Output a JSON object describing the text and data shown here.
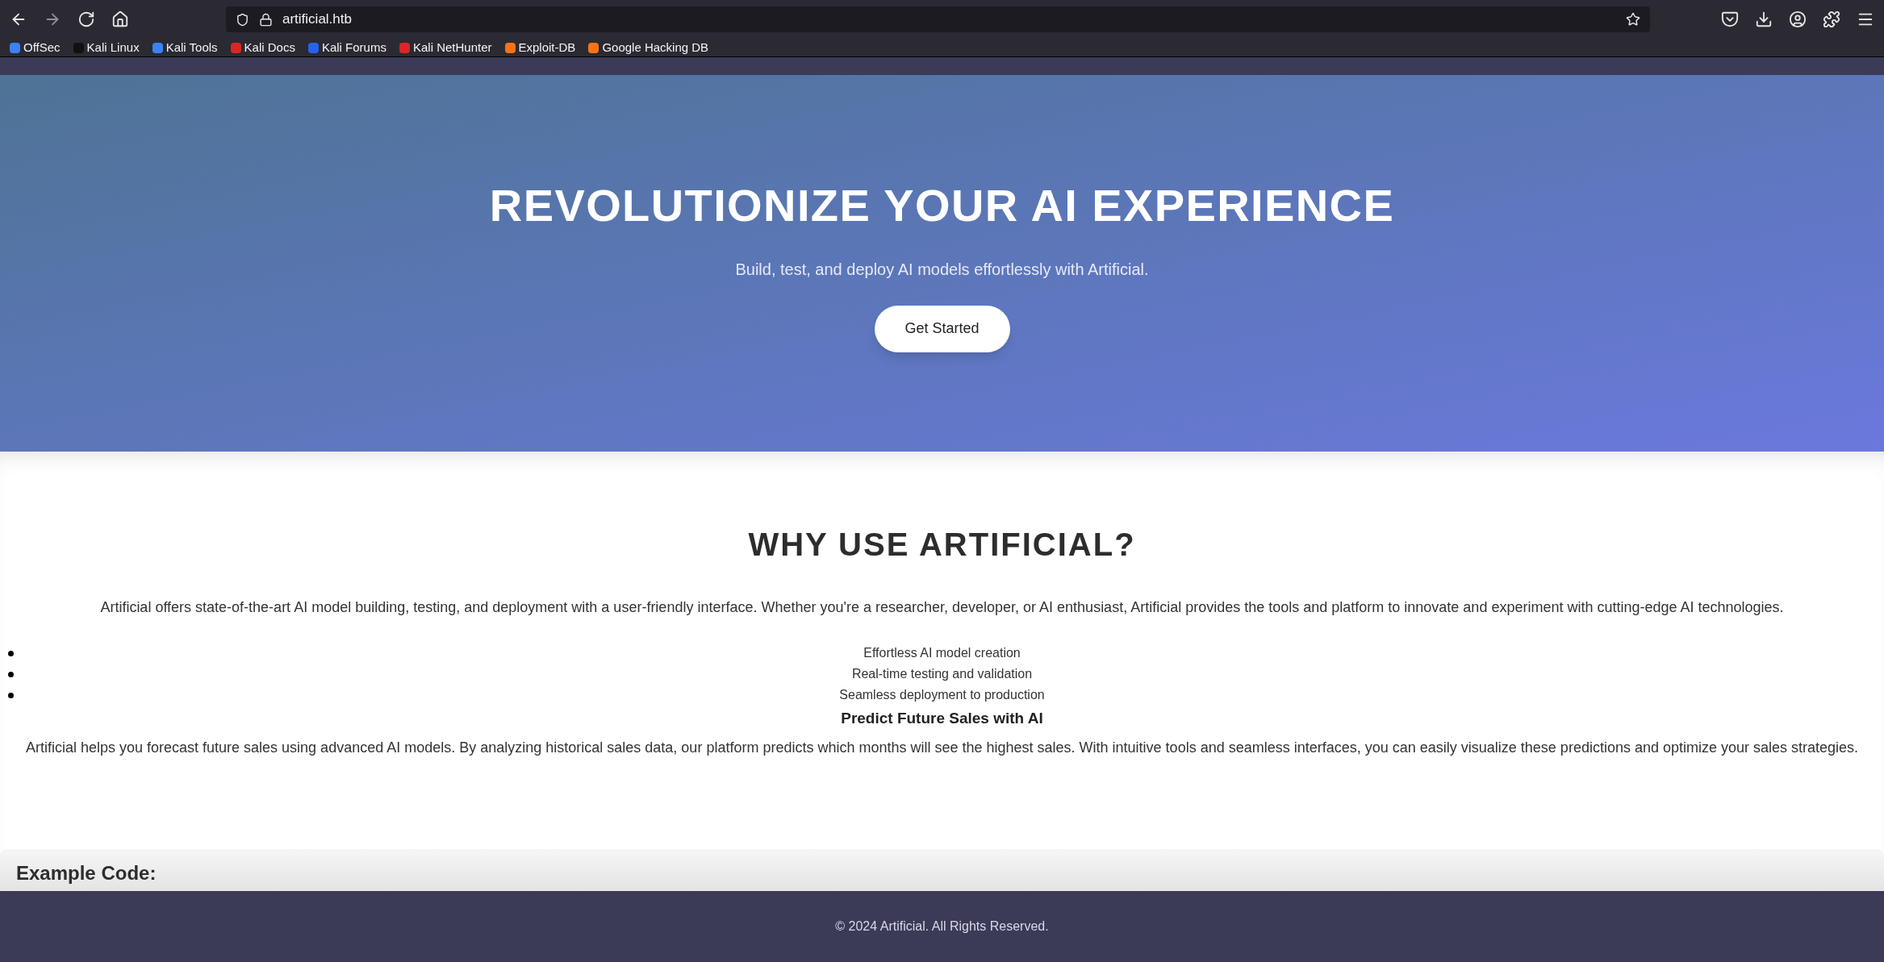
{
  "browser": {
    "url": "artificial.htb",
    "bookmarks": [
      {
        "label": "OffSec",
        "color": "#3b82f6"
      },
      {
        "label": "Kali Linux",
        "color": "#111111"
      },
      {
        "label": "Kali Tools",
        "color": "#3b82f6"
      },
      {
        "label": "Kali Docs",
        "color": "#dc2626"
      },
      {
        "label": "Kali Forums",
        "color": "#2563eb"
      },
      {
        "label": "Kali NetHunter",
        "color": "#dc2626"
      },
      {
        "label": "Exploit-DB",
        "color": "#f97316"
      },
      {
        "label": "Google Hacking DB",
        "color": "#f97316"
      }
    ]
  },
  "hero": {
    "title": "REVOLUTIONIZE YOUR AI EXPERIENCE",
    "subtitle": "Build, test, and deploy AI models effortlessly with Artificial.",
    "button": "Get Started"
  },
  "about": {
    "heading": "WHY USE ARTIFICIAL?",
    "intro": "Artificial offers state-of-the-art AI model building, testing, and deployment with a user-friendly interface. Whether you're a researcher, developer, or AI enthusiast, Artificial provides the tools and platform to innovate and experiment with cutting-edge AI technologies.",
    "features": [
      "Effortless AI model creation",
      "Real-time testing and validation",
      "Seamless deployment to production"
    ],
    "subheading": "Predict Future Sales with AI",
    "description": "Artificial helps you forecast future sales using advanced AI models. By analyzing historical sales data, our platform predicts which months will see the highest sales. With intuitive tools and seamless interfaces, you can easily visualize these predictions and optimize your sales strategies."
  },
  "example": {
    "heading": "Example Code:"
  },
  "footer": {
    "text": "© 2024 Artificial. All Rights Reserved."
  }
}
